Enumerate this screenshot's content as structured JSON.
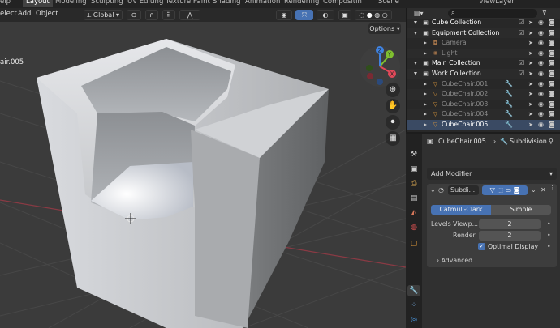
{
  "top_tabs": [
    {
      "label": "elp",
      "active": false
    },
    {
      "label": "Layout",
      "active": true
    },
    {
      "label": "Modeling",
      "active": false
    },
    {
      "label": "Sculpting",
      "active": false
    },
    {
      "label": "UV Editing",
      "active": false
    },
    {
      "label": "Texture Paint",
      "active": false
    },
    {
      "label": "Shading",
      "active": false
    },
    {
      "label": "Animation",
      "active": false
    },
    {
      "label": "Rendering",
      "active": false
    },
    {
      "label": "Compositin",
      "active": false
    },
    {
      "label": "Scene",
      "active": false
    },
    {
      "label": "ViewLayer",
      "active": false
    }
  ],
  "viewport": {
    "menu": [
      "elect",
      "Add",
      "Object"
    ],
    "transform_orientation": "Global",
    "options_label": "Options",
    "object_name": "air.005",
    "gizmo_axes": {
      "x": "X",
      "y": "Y",
      "z": "Z"
    }
  },
  "outliner": {
    "rows": [
      {
        "label": "Cube Collection",
        "color": "#ffffff",
        "indent": 1,
        "icon": "collection-icon"
      },
      {
        "label": "Equipment Collection",
        "color": "#ffffff",
        "indent": 1,
        "icon": "collection-icon"
      },
      {
        "label": "Camera",
        "color": "#8a8a8a",
        "indent": 2,
        "icon": "camera-icon"
      },
      {
        "label": "Light",
        "color": "#8a8a8a",
        "indent": 2,
        "icon": "light-icon"
      },
      {
        "label": "Main Collection",
        "color": "#ffffff",
        "indent": 1,
        "icon": "collection-icon"
      },
      {
        "label": "Work Collection",
        "color": "#ffffff",
        "indent": 1,
        "icon": "collection-icon"
      },
      {
        "label": "CubeChair.001",
        "color": "#8a8a8a",
        "indent": 2,
        "icon": "mesh-icon"
      },
      {
        "label": "CubeChair.002",
        "color": "#8a8a8a",
        "indent": 2,
        "icon": "mesh-icon"
      },
      {
        "label": "CubeChair.003",
        "color": "#8a8a8a",
        "indent": 2,
        "icon": "mesh-icon"
      },
      {
        "label": "CubeChair.004",
        "color": "#8a8a8a",
        "indent": 2,
        "icon": "mesh-icon"
      },
      {
        "label": "CubeChair.005",
        "color": "#ffffff",
        "indent": 2,
        "icon": "mesh-icon"
      }
    ]
  },
  "properties": {
    "breadcrumb_object": "CubeChair.005",
    "breadcrumb_modifier": "Subdivision",
    "add_modifier": "Add Modifier",
    "modifier_name": "Subdi...",
    "mode_catmull": "Catmull-Clark",
    "mode_simple": "Simple",
    "levels_viewport_label": "Levels Viewp...",
    "levels_viewport_value": "2",
    "render_label": "Render",
    "render_value": "2",
    "optimal_display_label": "Optimal Display",
    "advanced_label": "Advanced"
  },
  "colors": {
    "accent": "#4772b3",
    "axis_x": "#e2495a",
    "axis_y": "#7fbf2f",
    "axis_z": "#3f82e0"
  }
}
